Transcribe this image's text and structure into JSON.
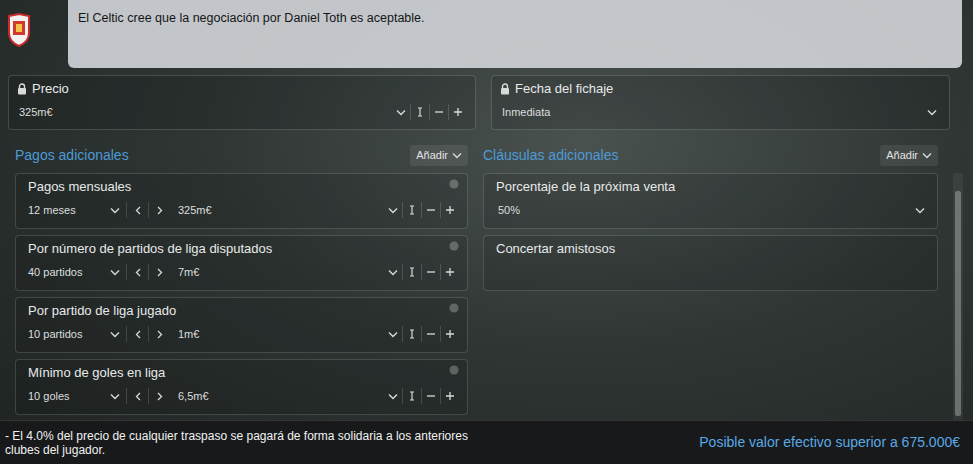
{
  "message": {
    "text": "El Celtic cree que la negociación por Daniel Toth es aceptable."
  },
  "price": {
    "label": "Precio",
    "locked": true,
    "value": "325m€"
  },
  "transfer_date": {
    "label": "Fecha del fichaje",
    "locked": true,
    "value": "Inmediata"
  },
  "additional_payments": {
    "title": "Pagos adicionales",
    "add_button": "Añadir",
    "items": [
      {
        "label": "Pagos mensuales",
        "condition": "12 meses",
        "amount": "325m€"
      },
      {
        "label": "Por número de partidos de liga disputados",
        "condition": "40 partidos",
        "amount": "7m€"
      },
      {
        "label": "Por partido de liga jugado",
        "condition": "10 partidos",
        "amount": "1m€"
      },
      {
        "label": "Mínimo de goles en liga",
        "condition": "10 goles",
        "amount": "6,5m€"
      }
    ]
  },
  "additional_clauses": {
    "title": "Cláusulas adicionales",
    "add_button": "Añadir",
    "items": [
      {
        "label": "Porcentaje de la próxima venta",
        "kind": "dropdown",
        "value": "50%"
      },
      {
        "label": "Concertar amistosos",
        "kind": "empty"
      }
    ]
  },
  "footer": {
    "note": "- El 4.0% del precio de cualquier traspaso se pagará de forma solidaria a los anteriores clubes del jugador.",
    "effective_value": "Posible valor efectivo superior a 675.000€"
  }
}
